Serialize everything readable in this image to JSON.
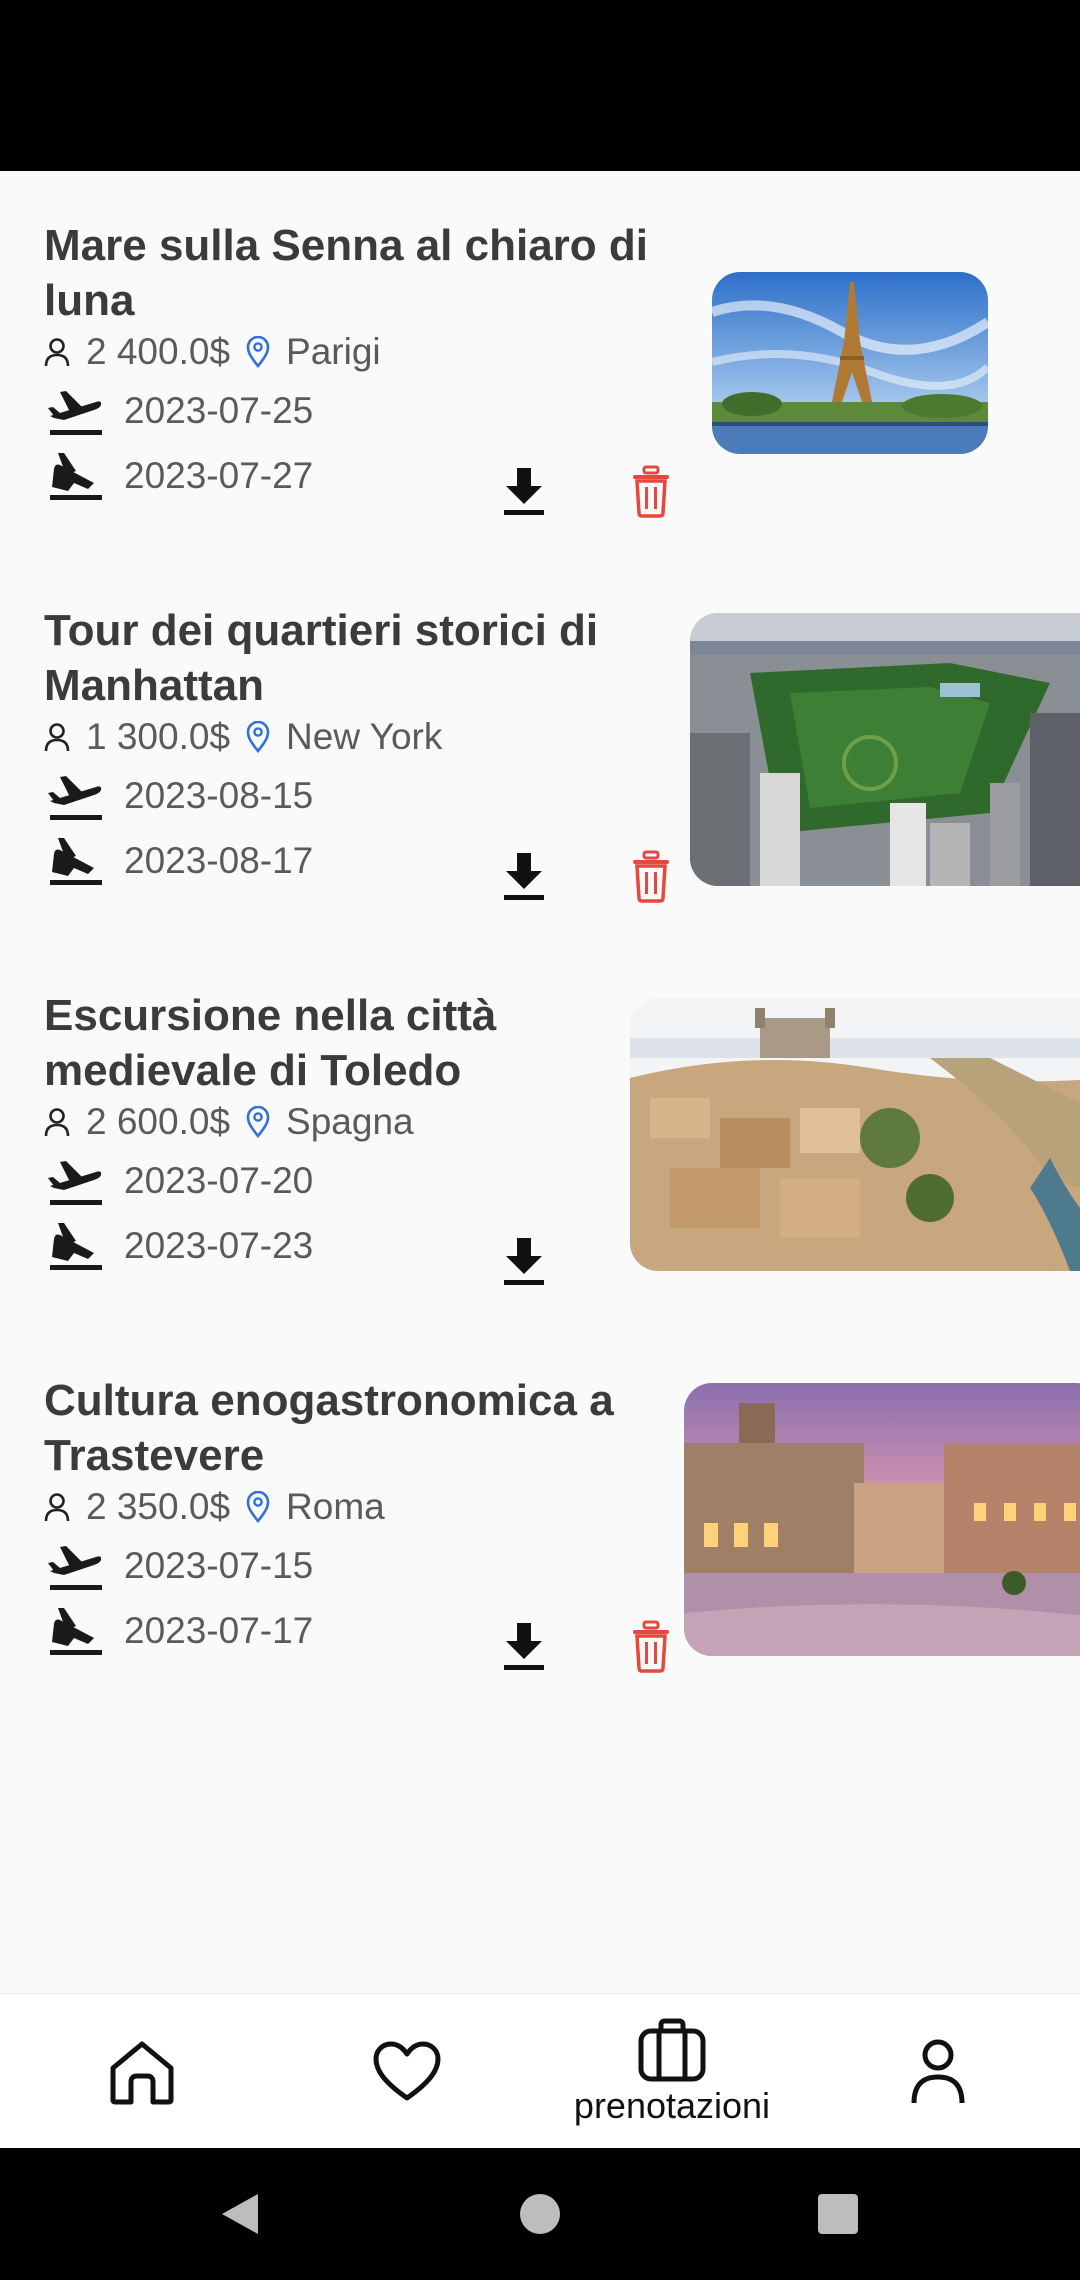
{
  "trips": [
    {
      "title": "Mare sulla Senna al chiaro di luna",
      "price": "2 400.0$",
      "location": "Parigi",
      "departure": "2023-07-25",
      "arrival": "2023-07-27",
      "image": "eiffel-tower-paris",
      "actions": [
        "download-icon",
        "trash-icon"
      ]
    },
    {
      "title": "Tour dei quartieri storici di Manhattan",
      "price": "1 300.0$",
      "location": "New York",
      "departure": "2023-08-15",
      "arrival": "2023-08-17",
      "image": "central-park-aerial",
      "actions": [
        "download-icon",
        "trash-icon"
      ]
    },
    {
      "title": "Escursione nella città medievale di Toledo",
      "price": "2 600.0$",
      "location": "Spagna",
      "departure": "2023-07-20",
      "arrival": "2023-07-23",
      "image": "toledo-cityscape",
      "actions": [
        "download-icon"
      ]
    },
    {
      "title": "Cultura enogastronomica a Trastevere",
      "price": "2 350.0$",
      "location": "Roma",
      "departure": "2023-07-15",
      "arrival": "2023-07-17",
      "image": "trastevere-piazza-dusk",
      "actions": [
        "download-icon",
        "trash-icon"
      ]
    }
  ],
  "bottom_nav": {
    "items": [
      {
        "icon": "home-icon"
      },
      {
        "icon": "heart-icon"
      },
      {
        "icon": "suitcase-icon",
        "label": "prenotazioni",
        "active": true
      },
      {
        "icon": "profile-icon"
      }
    ]
  },
  "system_nav": [
    "back-icon",
    "home-circle-icon",
    "recents-square-icon"
  ],
  "colors": {
    "trash": "#e5483c",
    "pin": "#2f6fe0",
    "title": "#3b3b3b",
    "meta": "#5a5a5a",
    "background": "#fafafa"
  }
}
